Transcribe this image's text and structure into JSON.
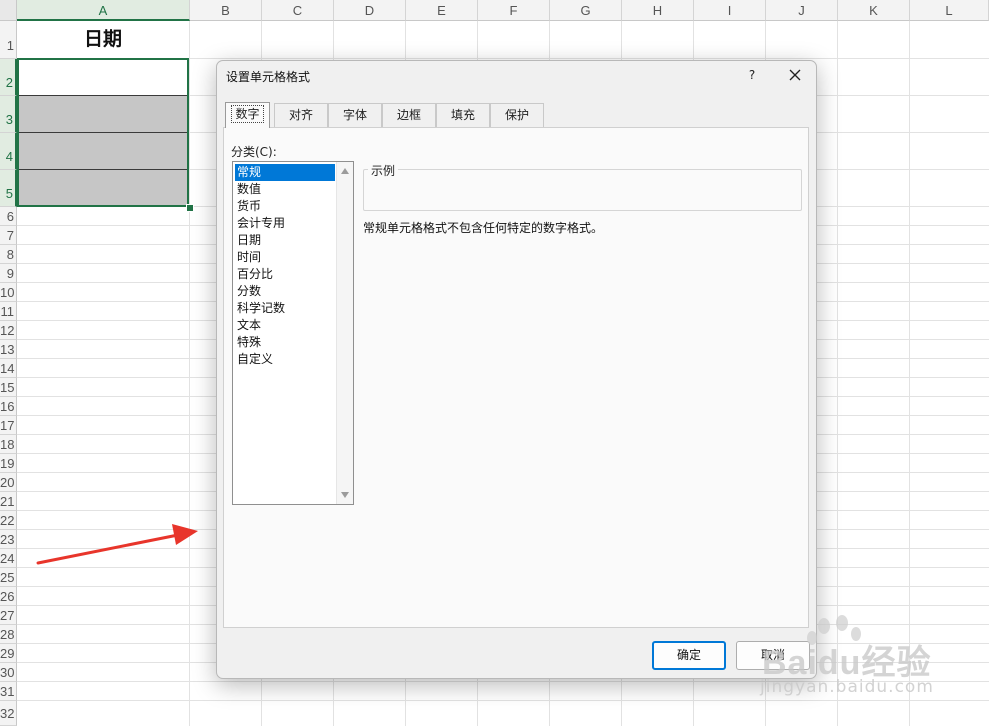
{
  "sheet": {
    "columns": [
      "A",
      "B",
      "C",
      "D",
      "E",
      "F",
      "G",
      "H",
      "I",
      "J",
      "K",
      "L"
    ],
    "rows": [
      "1",
      "2",
      "3",
      "4",
      "5",
      "6",
      "7",
      "8",
      "9",
      "10",
      "11",
      "12",
      "13",
      "14",
      "15",
      "16",
      "17",
      "18",
      "19",
      "20",
      "21",
      "22",
      "23",
      "24",
      "25",
      "26",
      "27",
      "28",
      "29",
      "30",
      "31",
      "32"
    ],
    "a1_value": "日期",
    "accent_color": "#217346"
  },
  "dialog": {
    "title": "设置单元格格式",
    "help_label": "?",
    "tabs": [
      "数字",
      "对齐",
      "字体",
      "边框",
      "填充",
      "保护"
    ],
    "active_tab": "数字",
    "category_label": "分类(C):",
    "categories": [
      "常规",
      "数值",
      "货币",
      "会计专用",
      "日期",
      "时间",
      "百分比",
      "分数",
      "科学记数",
      "文本",
      "特殊",
      "自定义"
    ],
    "selected_category": "常规",
    "sample_label": "示例",
    "description": "常规单元格格式不包含任何特定的数字格式。",
    "ok_label": "确定",
    "cancel_label": "取消",
    "selection_color": "#0078d7"
  },
  "watermark": {
    "brand": "Baidu经验",
    "url": "jingyan.baidu.com"
  },
  "annotation": {
    "arrow_color": "#e8352b"
  }
}
